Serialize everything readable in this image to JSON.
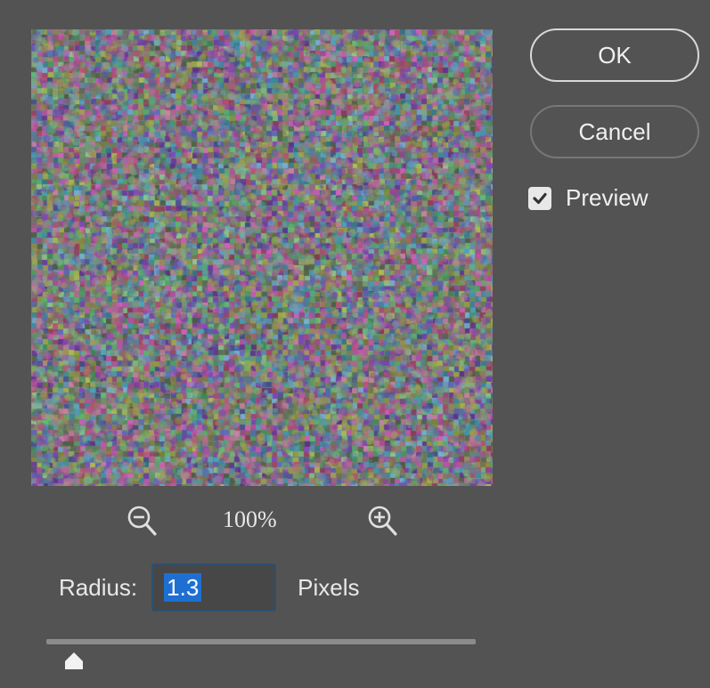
{
  "buttons": {
    "ok_label": "OK",
    "cancel_label": "Cancel"
  },
  "preview": {
    "label": "Preview",
    "checked": true
  },
  "zoom": {
    "level": "100%",
    "zoom_out_icon": "zoom-out-icon",
    "zoom_in_icon": "zoom-in-icon"
  },
  "radius": {
    "label": "Radius:",
    "value": "1.3",
    "units": "Pixels"
  },
  "slider": {
    "value": 1.3,
    "min": 0.1,
    "max": 1000,
    "fraction": 0.065
  },
  "colors": {
    "background": "#535353",
    "selection": "#1e6fd1",
    "button_border": "#d8d8d8"
  }
}
